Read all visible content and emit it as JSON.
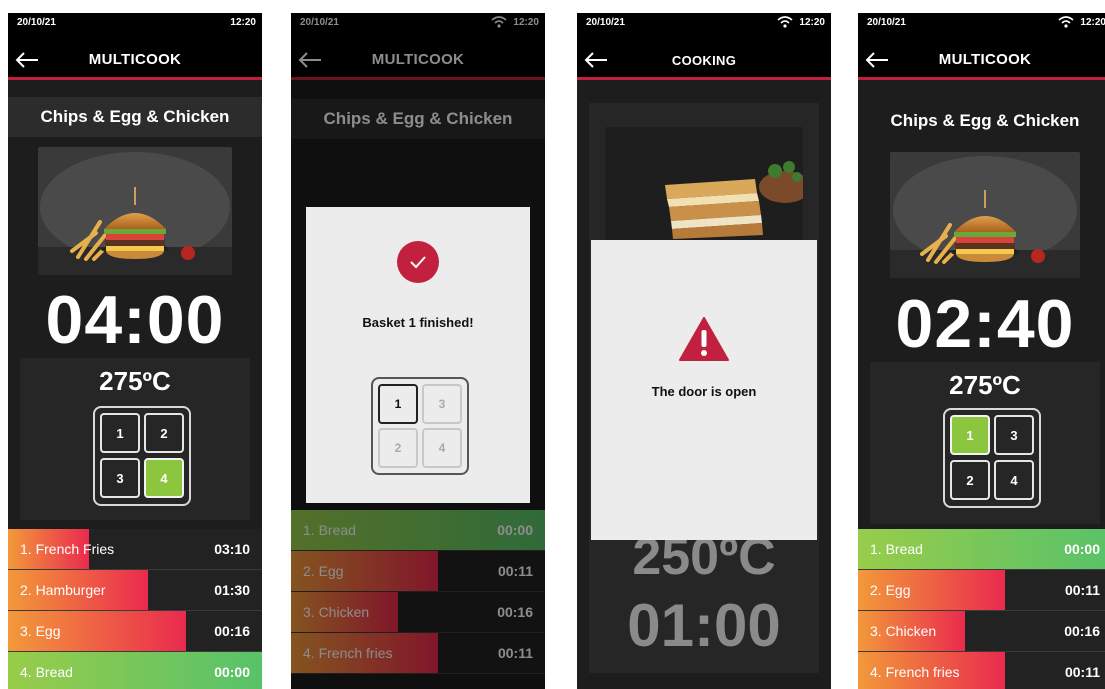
{
  "status": {
    "date": "20/10/21",
    "time": "12:20"
  },
  "screen1": {
    "nav_title": "MULTICOOK",
    "recipe": "Chips & Egg & Chicken",
    "timer": "04:00",
    "temperature": "275ºC",
    "baskets": [
      "1",
      "2",
      "3",
      "4"
    ],
    "active_basket": "4",
    "items": [
      {
        "label": "1. French Fries",
        "time": "03:10",
        "color": "red",
        "progress": 0.32
      },
      {
        "label": "2. Hamburger",
        "time": "01:30",
        "color": "red",
        "progress": 0.55
      },
      {
        "label": "3. Egg",
        "time": "00:16",
        "color": "red",
        "progress": 0.7
      },
      {
        "label": "4. Bread",
        "time": "00:00",
        "color": "green",
        "progress": 1.0
      }
    ]
  },
  "screen2": {
    "nav_title": "MULTICOOK",
    "recipe": "Chips & Egg & Chicken",
    "dialog_message": "Basket 1 finished!",
    "dialog_baskets": [
      "1",
      "3",
      "2",
      "4"
    ],
    "items": [
      {
        "label": "1. Bread",
        "time": "00:00",
        "color": "green",
        "progress": 1.0
      },
      {
        "label": "2. Egg",
        "time": "00:11",
        "color": "red",
        "progress": 0.58
      },
      {
        "label": "3. Chicken",
        "time": "00:16",
        "color": "red",
        "progress": 0.42
      },
      {
        "label": "4. French fries",
        "time": "00:11",
        "color": "red",
        "progress": 0.58
      }
    ]
  },
  "screen3": {
    "nav_title": "COOKING",
    "temperature_partial": "250ºC",
    "timer": "01:00",
    "dialog_message": "The door is open"
  },
  "screen4": {
    "nav_title": "MULTICOOK",
    "recipe": "Chips & Egg & Chicken",
    "timer": "02:40",
    "temperature": "275ºC",
    "baskets": [
      "1",
      "3",
      "2",
      "4"
    ],
    "active_basket": "1",
    "items": [
      {
        "label": "1. Bread",
        "time": "00:00",
        "color": "green",
        "progress": 1.0
      },
      {
        "label": "2. Egg",
        "time": "00:11",
        "color": "red",
        "progress": 0.58
      },
      {
        "label": "3. Chicken",
        "time": "00:16",
        "color": "red",
        "progress": 0.42
      },
      {
        "label": "4. French fries",
        "time": "00:11",
        "color": "red",
        "progress": 0.58
      }
    ]
  },
  "colors": {
    "accent": "#c2203f",
    "green": "#8cc63f",
    "warning": "#c2203f"
  }
}
